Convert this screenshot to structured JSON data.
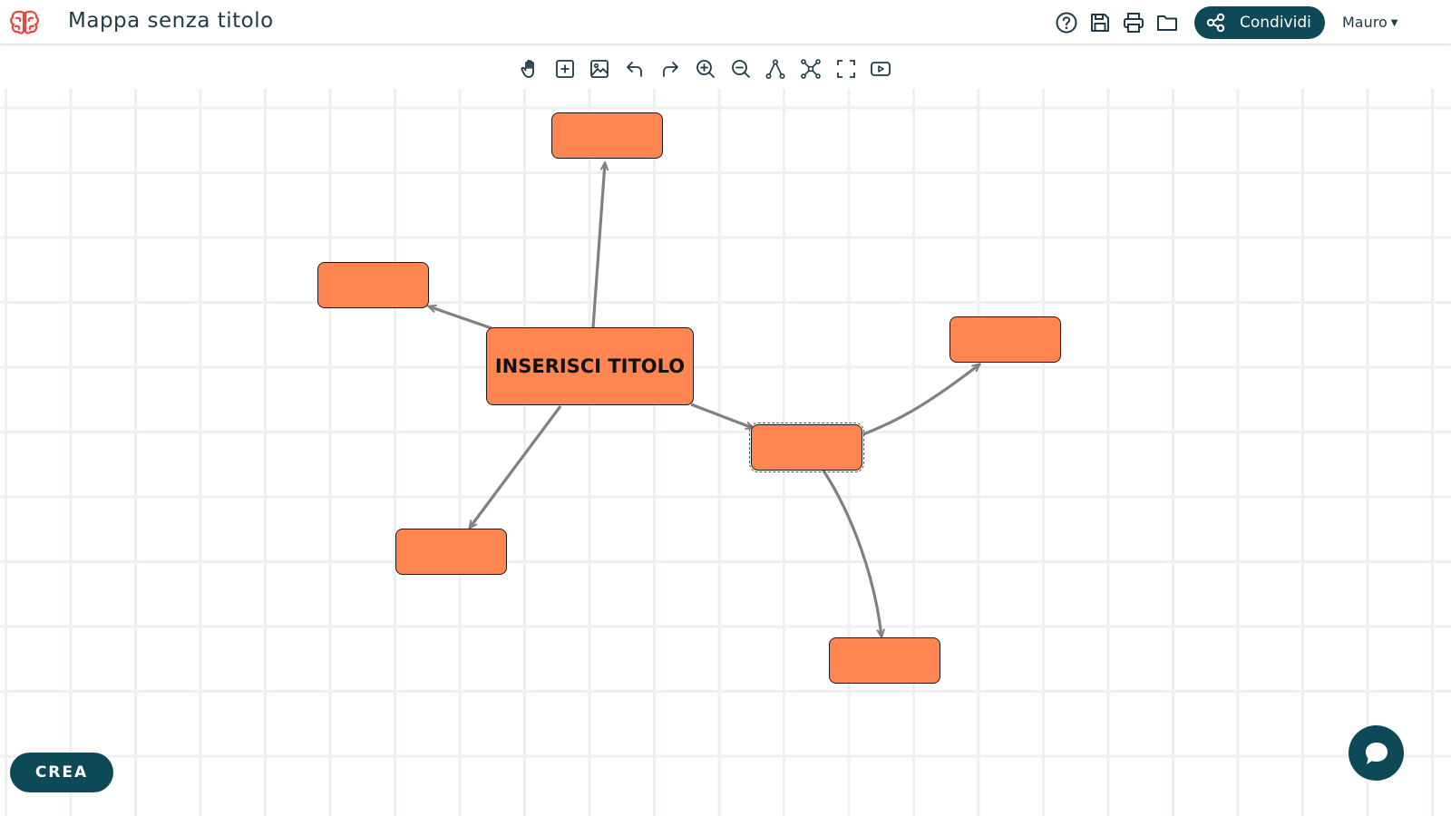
{
  "app": {
    "title": "Mappa senza titolo",
    "brand_color": "#e8453c",
    "accent_color": "#0e4957"
  },
  "header": {
    "icons": [
      "help-icon",
      "save-icon",
      "print-icon",
      "folder-icon"
    ],
    "share_label": "Condividi",
    "user_name": "Mauro"
  },
  "toolbar": {
    "tools": [
      "pan-hand-icon",
      "add-node-icon",
      "image-icon",
      "undo-icon",
      "redo-icon",
      "zoom-in-icon",
      "zoom-out-icon",
      "connect-nodes-icon",
      "layout-icon",
      "fullscreen-icon",
      "presentation-icon"
    ]
  },
  "map": {
    "node_color": "#ff8650",
    "edge_color": "#808080",
    "central_label": "INSERISCI TITOLO",
    "child_labels": [
      "",
      "",
      "",
      "",
      "",
      ""
    ],
    "selected_node": "right-child"
  },
  "footer": {
    "create_label": "CREA"
  }
}
